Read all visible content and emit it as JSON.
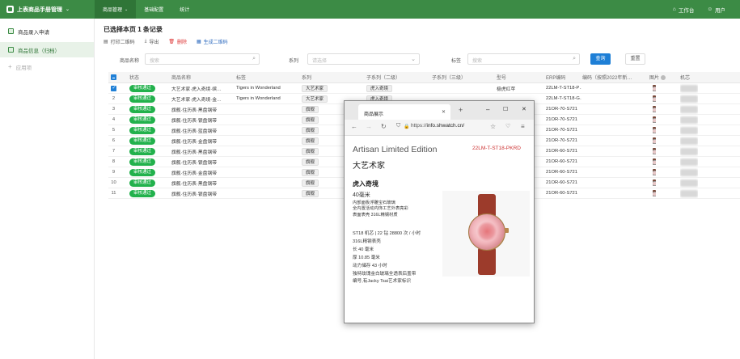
{
  "app": {
    "title": "上表商品手册管理"
  },
  "topnav": [
    {
      "label": "商品管理"
    },
    {
      "label": "基础配置"
    },
    {
      "label": "统计"
    }
  ],
  "topright": {
    "workspace": "工作台",
    "user": "用户"
  },
  "sidebar": {
    "items": [
      {
        "label": "商品录入申请"
      },
      {
        "label": "商品信息（归档）"
      },
      {
        "label": "应用项"
      }
    ]
  },
  "main": {
    "selection_title": "已选择本页 1 条记录",
    "toolbar": {
      "print_qr": "打印二维码",
      "export": "导出",
      "delete": "删除",
      "gen_qr": "生成二维码"
    },
    "filters": {
      "name_label": "商品名称",
      "name_placeholder": "搜索",
      "series_label": "系列",
      "series_placeholder": "请选择",
      "tag_label": "标签",
      "tag_placeholder": "搜索",
      "query": "查询",
      "reset": "重置"
    }
  },
  "table": {
    "headers": {
      "status": "状态",
      "name": "商品名称",
      "tag": "标签",
      "series": "系列",
      "sub1": "子系列（二级）",
      "sub2": "子系列（三级）",
      "model": "型号",
      "erp": "ERP编码",
      "code": "编码（按照2022年新…",
      "image": "图片",
      "mechanism": "机芯"
    },
    "rows": [
      {
        "idx": "",
        "checked": true,
        "status": "审核通过",
        "name": "大艺术家·虎入奇境·缤…",
        "tag": "Tigers in Wonderland",
        "series": "大艺术家",
        "sub1": "虎入奇境",
        "model": "极虎红苹",
        "erp": "22LM-T-ST18-P…"
      },
      {
        "idx": "2",
        "checked": false,
        "status": "审核通过",
        "name": "大艺术家·虎入奇境·金…",
        "tag": "Tigers in Wonderland",
        "series": "大艺术家",
        "sub1": "虎入奇境",
        "model": "",
        "erp": "22LM-T-ST18-G…"
      },
      {
        "idx": "3",
        "checked": false,
        "status": "审核通过",
        "name": "旗舰·住历表·黑盘钢带",
        "tag": "",
        "series": "旗舰",
        "sub1": "",
        "model": "",
        "erp": "21OR-70-S721"
      },
      {
        "idx": "4",
        "checked": false,
        "status": "审核通过",
        "name": "旗舰·住历表·银盘钢带",
        "tag": "",
        "series": "旗舰",
        "sub1": "",
        "model": "",
        "erp": "21OR-70-S721"
      },
      {
        "idx": "5",
        "checked": false,
        "status": "审核通过",
        "name": "旗舰·住历表·蓝盘钢带",
        "tag": "",
        "series": "旗舰",
        "sub1": "",
        "model": "",
        "erp": "21OR-70-S721"
      },
      {
        "idx": "6",
        "checked": false,
        "status": "审核通过",
        "name": "旗舰·住历表·金盘钢带",
        "tag": "",
        "series": "旗舰",
        "sub1": "",
        "model": "",
        "erp": "21OR-70-S721"
      },
      {
        "idx": "7",
        "checked": false,
        "status": "审核通过",
        "name": "旗舰·住历表·黑盘钢带",
        "tag": "",
        "series": "旗舰",
        "sub1": "",
        "model": "",
        "erp": "21OR-60-S721"
      },
      {
        "idx": "8",
        "checked": false,
        "status": "审核通过",
        "name": "旗舰·住历表·银盘钢带",
        "tag": "",
        "series": "旗舰",
        "sub1": "",
        "model": "",
        "erp": "21OR-60-S721"
      },
      {
        "idx": "9",
        "checked": false,
        "status": "审核通过",
        "name": "旗舰·住历表·金盘钢带",
        "tag": "",
        "series": "旗舰",
        "sub1": "",
        "model": "",
        "erp": "21OR-60-S721"
      },
      {
        "idx": "10",
        "checked": false,
        "status": "审核通过",
        "name": "旗舰·住历表·黑盘钢带",
        "tag": "",
        "series": "旗舰",
        "sub1": "",
        "model": "",
        "erp": "21OR-60-S721"
      },
      {
        "idx": "11",
        "checked": false,
        "status": "审核通过",
        "name": "旗舰·住历表·银盘钢带",
        "tag": "",
        "series": "旗舰",
        "sub1": "",
        "model": "",
        "erp": "21OR-60-S721"
      }
    ]
  },
  "popup": {
    "tab_title": "商品展示",
    "url_prefix": "https://",
    "url_host": "info.shwatch.cn/",
    "heading": "Artisan Limited Edition",
    "code": "22LM-T-ST18-PKRD",
    "subheading": "大艺术家",
    "product_name": "虎入奇境",
    "size": "40毫米",
    "desc_lines": [
      "内部面板浮雕宝石玻璃",
      "全内置活动内饰工艺外表亮彩",
      "表面表壳 316L精钢材质"
    ],
    "specs": [
      "ST18 机芯 | 22 钻 28800 次 / 小时",
      "316L精钢表壳",
      "长 40 毫米",
      "厚 10.85 毫米",
      "动力储存 43 小时",
      "独特玫瑰金白玻璃全透表后盖带",
      "编号,有Jacky Tsai艺术家标识"
    ]
  }
}
